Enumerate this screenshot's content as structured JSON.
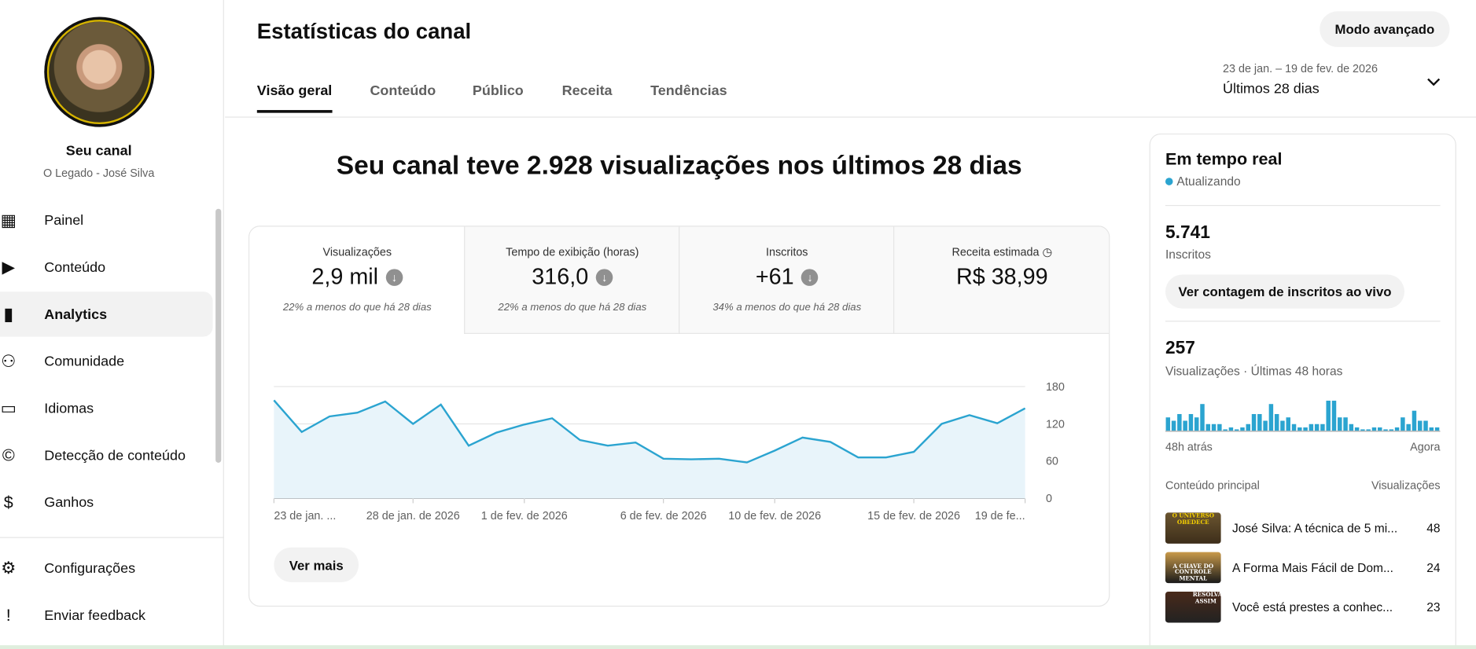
{
  "channel": {
    "label": "Seu canal",
    "name": "O Legado - José Silva"
  },
  "nav": [
    {
      "label": "Painel",
      "icon": "dashboard-icon"
    },
    {
      "label": "Conteúdo",
      "icon": "content-icon"
    },
    {
      "label": "Analytics",
      "icon": "analytics-icon"
    },
    {
      "label": "Comunidade",
      "icon": "community-icon"
    },
    {
      "label": "Idiomas",
      "icon": "subtitles-icon"
    },
    {
      "label": "Detecção de conteúdo",
      "icon": "copyright-icon"
    },
    {
      "label": "Ganhos",
      "icon": "dollar-icon"
    }
  ],
  "nav_bottom": [
    {
      "label": "Configurações",
      "icon": "gear-icon"
    },
    {
      "label": "Enviar feedback",
      "icon": "feedback-icon"
    }
  ],
  "header": {
    "title": "Estatísticas do canal",
    "advanced": "Modo avançado",
    "date_range": "23 de jan. – 19 de fev. de 2026",
    "period": "Últimos 28 dias"
  },
  "tabs": [
    "Visão geral",
    "Conteúdo",
    "Público",
    "Receita",
    "Tendências"
  ],
  "headline": "Seu canal teve 2.928 visualizações nos últimos 28 dias",
  "metrics": [
    {
      "title": "Visualizações",
      "value": "2,9 mil",
      "compare": "22% a menos do que há 28 dias"
    },
    {
      "title": "Tempo de exibição (horas)",
      "value": "316,0",
      "compare": "22% a menos do que há 28 dias"
    },
    {
      "title": "Inscritos",
      "value": "+61",
      "compare": "34% a menos do que há 28 dias"
    },
    {
      "title": "Receita estimada",
      "value": "R$ 38,99"
    }
  ],
  "see_more": "Ver mais",
  "chart_data": {
    "type": "area",
    "title": "Visualizações",
    "x_tick_labels": [
      "23 de jan. ...",
      "28 de jan. de 2026",
      "1 de fev. de 2026",
      "6 de fev. de 2026",
      "10 de fev. de 2026",
      "15 de fev. de 2026",
      "19 de fe..."
    ],
    "x_tick_index": [
      0,
      5,
      9,
      14,
      18,
      23,
      27
    ],
    "y_ticks": [
      "180",
      "120",
      "60",
      "0"
    ],
    "ylim": [
      0,
      180
    ],
    "values": [
      158,
      107,
      132,
      138,
      156,
      120,
      151,
      85,
      106,
      119,
      129,
      94,
      85,
      90,
      64,
      63,
      64,
      58,
      77,
      98,
      91,
      66,
      66,
      75,
      120,
      134,
      121,
      145
    ],
    "color": "#2ba4d0"
  },
  "realtime": {
    "title": "Em tempo real",
    "status": "Atualizando",
    "subs": "5.741",
    "subs_label": "Inscritos",
    "live_button": "Ver contagem de inscritos ao vivo",
    "views": "257",
    "views_label": "Visualizações · Últimas 48 horas",
    "bars": [
      4,
      3,
      5,
      3,
      5,
      4,
      8,
      2,
      2,
      2,
      0,
      1,
      0,
      1,
      2,
      5,
      5,
      3,
      8,
      5,
      3,
      4,
      2,
      1,
      1,
      2,
      2,
      2,
      9,
      9,
      4,
      4,
      2,
      1,
      0,
      0,
      1,
      1,
      0,
      0,
      1,
      4,
      2,
      6,
      3,
      3,
      1,
      1
    ],
    "start": "48h atrás",
    "end": "Agora",
    "col_content": "Conteúdo principal",
    "col_views": "Visualizações",
    "top": [
      {
        "title": "José Silva: A técnica de 5 mi...",
        "views": "48",
        "thumb_text": "O UNIVERSO OBEDECE"
      },
      {
        "title": "A Forma Mais Fácil de Dom...",
        "views": "24",
        "thumb_text": "A CHAVE DO CONTROLE MENTAL"
      },
      {
        "title": "Você está prestes a conhec...",
        "views": "23",
        "thumb_text": "RESOLVA ASSIM"
      }
    ]
  }
}
